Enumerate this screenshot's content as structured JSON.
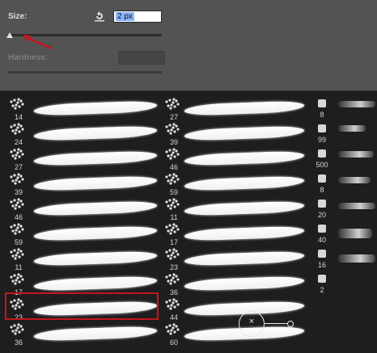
{
  "size": {
    "label": "Size:",
    "value": "2 px",
    "slider_fraction": 0.0
  },
  "hardness": {
    "label": "Hardness:",
    "value": ""
  },
  "brushes": {
    "column1": [
      "14",
      "24",
      "27",
      "39",
      "46",
      "59",
      "11",
      "17",
      "23",
      "36"
    ],
    "column2": [
      "27",
      "39",
      "46",
      "59",
      "11",
      "17",
      "23",
      "36",
      "44",
      "60"
    ],
    "column3": [
      "8",
      "99",
      "500",
      "8",
      "20",
      "40",
      "16",
      "2"
    ]
  },
  "selected_brush": "23",
  "colors": {
    "highlight": "#c3161c",
    "panel": "#535353",
    "grid": "#1e1e1e"
  }
}
